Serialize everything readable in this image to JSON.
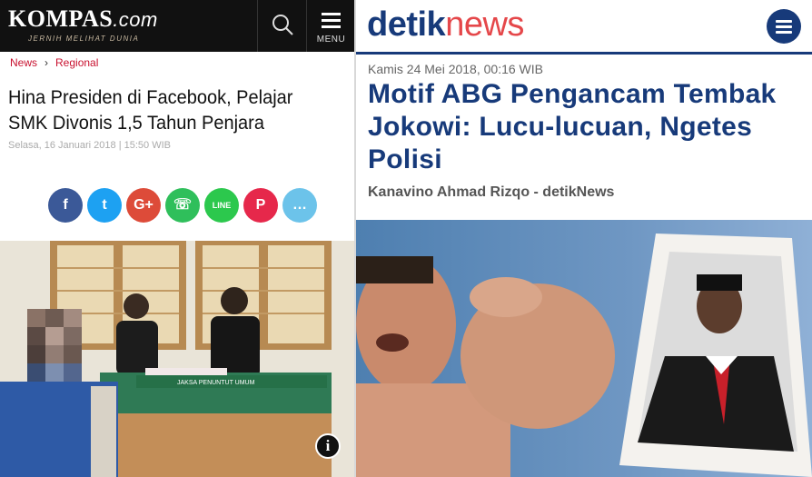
{
  "kompas": {
    "logo": "KOMPAS",
    "logo_com": ".com",
    "tagline": "JERNIH MELIHAT DUNIA",
    "menu_label": "MENU",
    "breadcrumb": [
      "News",
      "Regional"
    ],
    "breadcrumb_sep": "›",
    "title": "Hina Presiden di Facebook, Pelajar SMK Divonis 1,5 Tahun Penjara",
    "date": "Selasa, 16 Januari 2018 | 15:50 WIB",
    "share": [
      {
        "icon": "facebook-icon",
        "glyph": "f",
        "color": "#3b5998"
      },
      {
        "icon": "twitter-icon",
        "glyph": "t",
        "color": "#1da1f2"
      },
      {
        "icon": "google-plus-icon",
        "glyph": "G+",
        "color": "#dd4b39"
      },
      {
        "icon": "whatsapp-icon",
        "glyph": "☏",
        "color": "#2fbf5b"
      },
      {
        "icon": "line-icon",
        "glyph": "LINE",
        "color": "#2cc84d"
      },
      {
        "icon": "pinterest-icon",
        "glyph": "P",
        "color": "#e6284b"
      },
      {
        "icon": "comment-icon",
        "glyph": "…",
        "color": "#6cc3ea"
      }
    ],
    "photo_sign": "JAKSA PENUNTUT UMUM",
    "info_icon": "i"
  },
  "detik": {
    "logo_detik": "detik",
    "logo_news": "news",
    "date": "Kamis 24 Mei 2018, 00:16 WIB",
    "title": "Motif ABG Pengancam Tembak Jokowi: Lucu-lucuan, Ngetes Polisi",
    "author": "Kanavino Ahmad Rizqo - detikNews"
  }
}
